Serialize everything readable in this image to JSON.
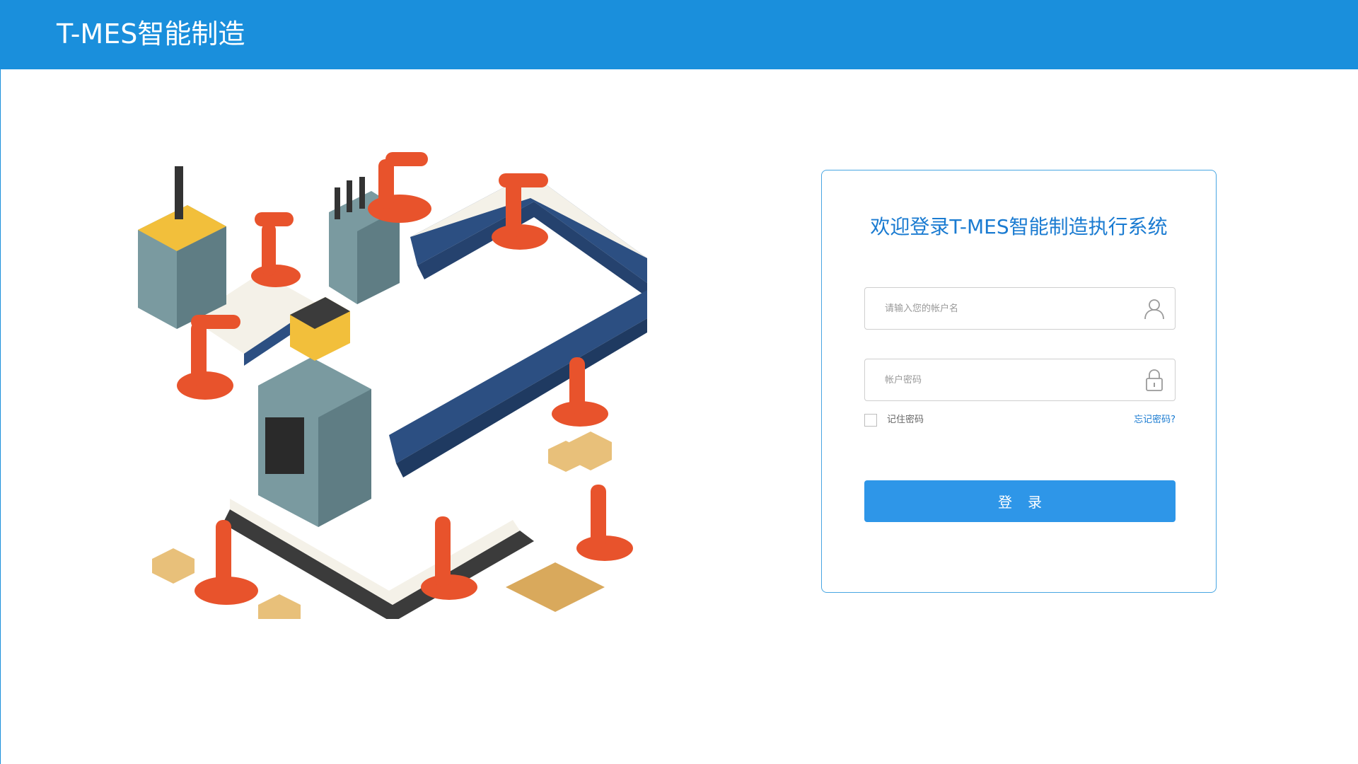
{
  "header": {
    "title": "T-MES智能制造"
  },
  "login": {
    "welcome": "欢迎登录T-MES智能制造执行系统",
    "username_placeholder": "请输入您的帐户名",
    "password_placeholder": "帐户密码",
    "remember_label": "记住密码",
    "forgot_label": "忘记密码?",
    "submit_label": "登录"
  },
  "icons": {
    "user": "user-icon",
    "lock": "lock-icon"
  },
  "colors": {
    "header_bg": "#1a8fdc",
    "accent": "#1a7bd1",
    "button_bg": "#2e96e8",
    "robot_orange": "#e8532c",
    "conveyor_blue": "#2c4f82",
    "machine_gray": "#7a9aa0",
    "machine_yellow": "#f2bf3b",
    "box_tan": "#e8c07a"
  }
}
